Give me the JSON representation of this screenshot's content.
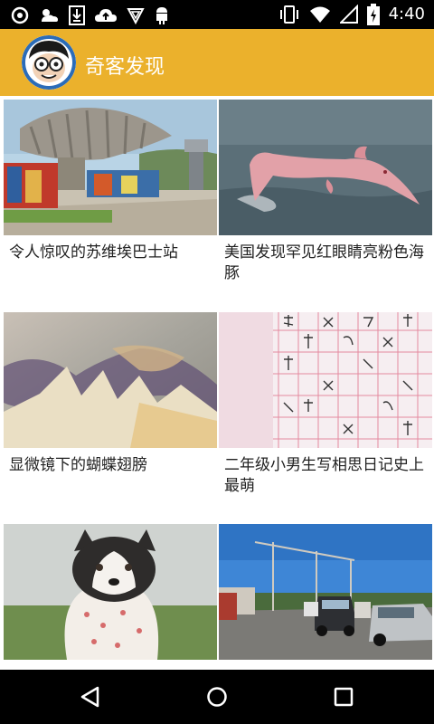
{
  "status_bar": {
    "time": "4:40",
    "left_icons": [
      "settings-ring-icon",
      "weather-icon",
      "download-icon",
      "cloud-upload-icon",
      "shield-icon",
      "android-icon"
    ],
    "right_icons": [
      "vibrate-icon",
      "wifi-icon",
      "signal-icon",
      "battery-charging-icon"
    ]
  },
  "app_bar": {
    "title": "奇客发现",
    "avatar_icon": "cartoon-avatar-icon",
    "color": "#ebb12c"
  },
  "cards": [
    {
      "caption": "令人惊叹的苏维埃巴士站",
      "image": "soviet-bus-stop-photo"
    },
    {
      "caption": "美国发现罕见红眼睛亮粉色海豚",
      "image": "pink-dolphin-photo"
    },
    {
      "caption": "显微镜下的蝴蝶翅膀",
      "image": "butterfly-wing-microscope-photo"
    },
    {
      "caption": "二年级小男生写相思日记史上最萌",
      "image": "handwritten-diary-photo"
    },
    {
      "caption": "",
      "image": "husky-puppy-photo"
    },
    {
      "caption": "",
      "image": "street-cars-photo"
    }
  ],
  "nav_bar": {
    "buttons": [
      "back-icon",
      "home-icon",
      "recents-icon"
    ]
  }
}
